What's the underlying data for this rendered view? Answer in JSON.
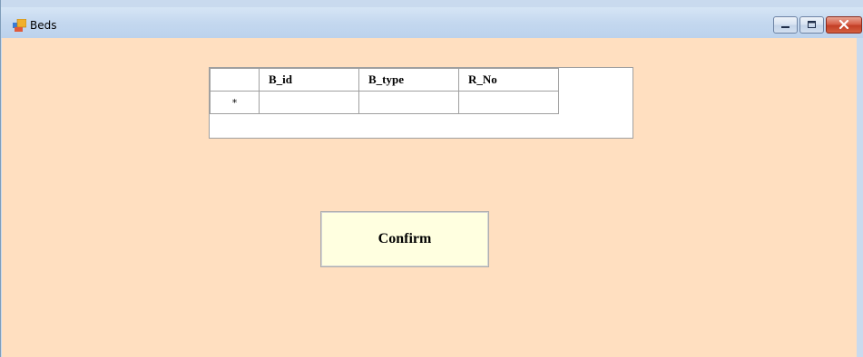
{
  "window": {
    "title": "Beds",
    "icon": "form-icon",
    "controls": {
      "minimize": "minimize-icon",
      "maximize": "maximize-icon",
      "close": "close-icon"
    }
  },
  "grid": {
    "columns": [
      "B_id",
      "B_type",
      "R_No"
    ],
    "new_row_marker": "*",
    "rows": [
      [
        "",
        "",
        ""
      ]
    ]
  },
  "confirm_button": {
    "label": "Confirm"
  },
  "colors": {
    "client_background": "#ffdfc0",
    "button_background": "#ffffe0",
    "titlebar": "#c4d8ef"
  }
}
